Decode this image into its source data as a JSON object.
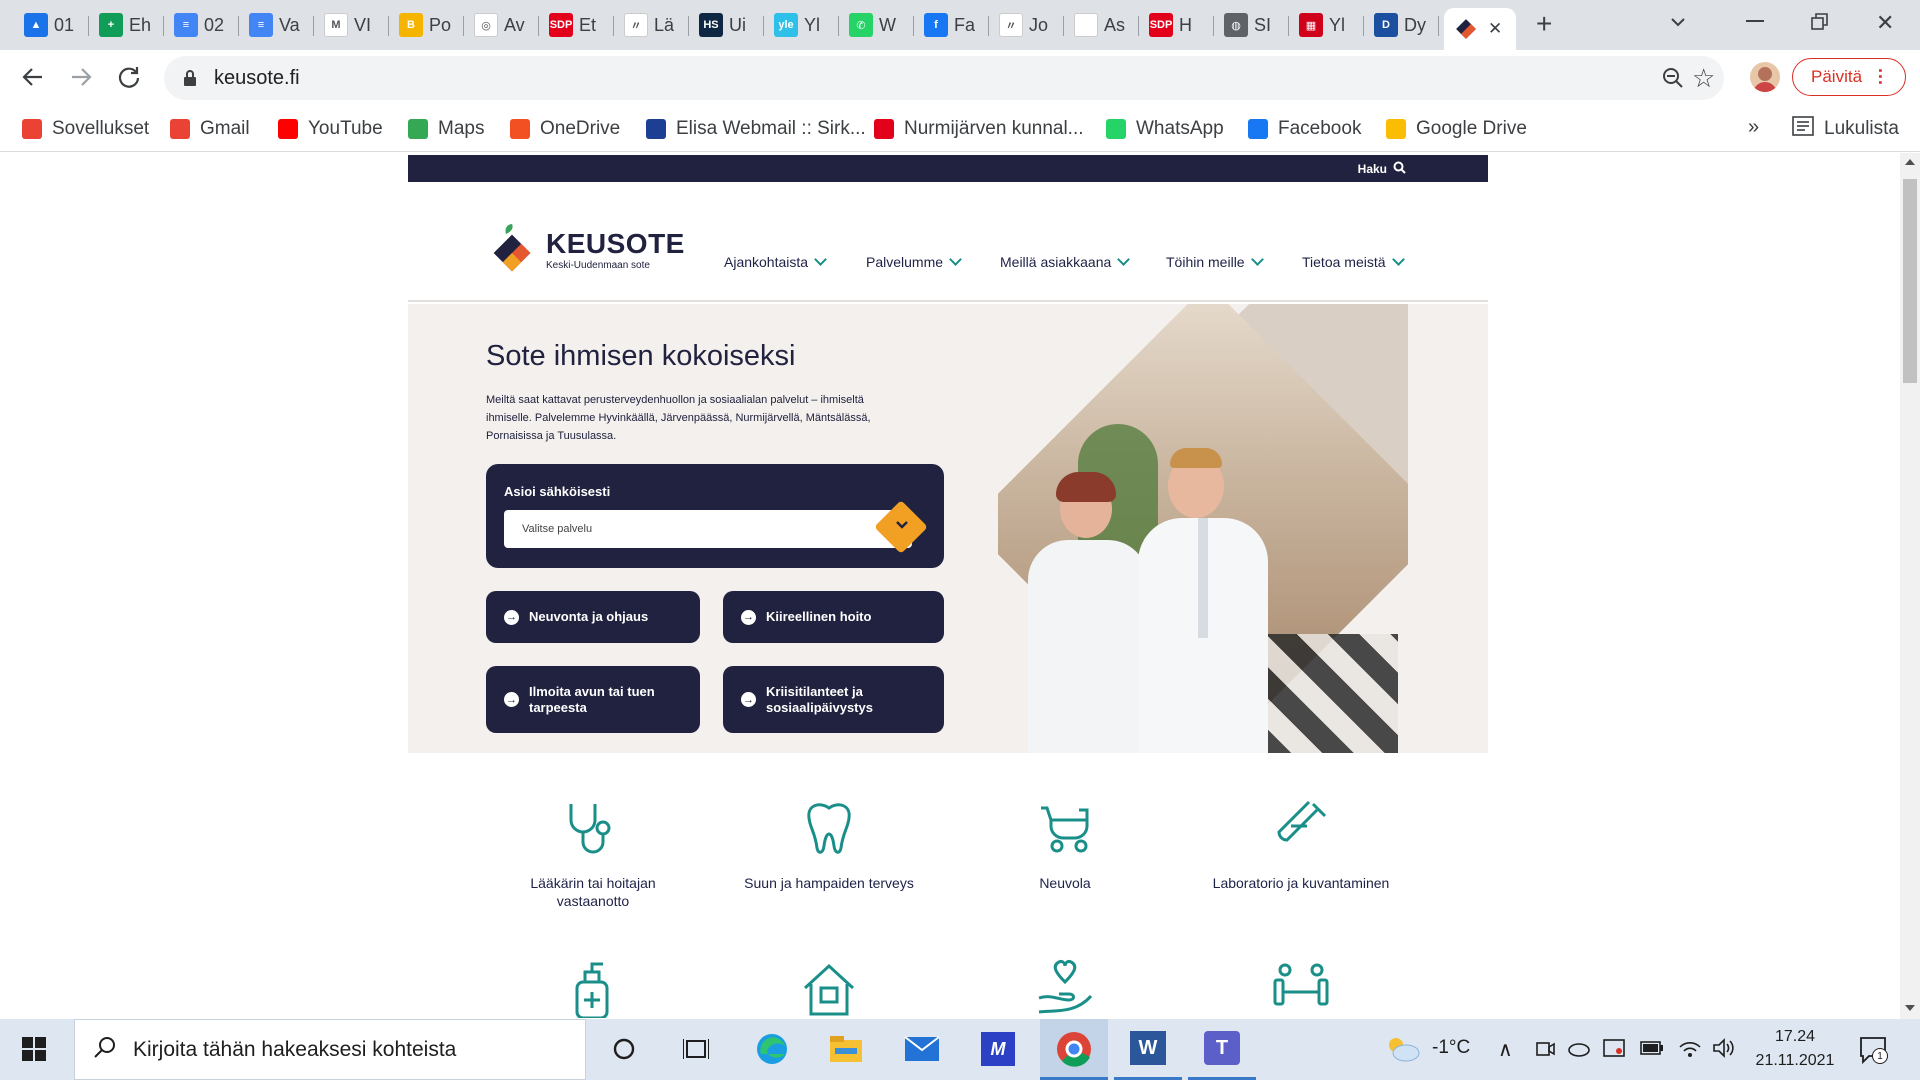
{
  "browser": {
    "tabs": [
      {
        "label": "01",
        "color": "#1a73e8",
        "glyph": "▲"
      },
      {
        "label": "Eh",
        "color": "#0f9d58",
        "glyph": "+"
      },
      {
        "label": "02",
        "color": "#4285f4",
        "glyph": "≡"
      },
      {
        "label": "Va",
        "color": "#4285f4",
        "glyph": "≡"
      },
      {
        "label": "VI",
        "color": "#ffffff",
        "glyph": "M"
      },
      {
        "label": "Po",
        "color": "#f4b400",
        "glyph": "B"
      },
      {
        "label": "Av",
        "color": "#ffffff",
        "glyph": "◎"
      },
      {
        "label": "Et",
        "color": "#e2001a",
        "glyph": "SDP"
      },
      {
        "label": "Lä",
        "color": "#ffffff",
        "glyph": "〃"
      },
      {
        "label": "Ui",
        "color": "#0e2743",
        "glyph": "HS"
      },
      {
        "label": "Yl",
        "color": "#2ec0e8",
        "glyph": "yle"
      },
      {
        "label": "W",
        "color": "#25d366",
        "glyph": "✆"
      },
      {
        "label": "Fa",
        "color": "#1877f2",
        "glyph": "f"
      },
      {
        "label": "Jo",
        "color": "#ffffff",
        "glyph": "〃"
      },
      {
        "label": "As",
        "color": "#ffffff",
        "glyph": ""
      },
      {
        "label": "H",
        "color": "#e2001a",
        "glyph": "SDP"
      },
      {
        "label": "SI",
        "color": "#5f6368",
        "glyph": "◍"
      },
      {
        "label": "Yl",
        "color": "#d0021b",
        "glyph": "▦"
      },
      {
        "label": "Dy",
        "color": "#1c4fa0",
        "glyph": "D"
      }
    ],
    "active_tab_close": "✕",
    "new_tab": "+",
    "url": "keusote.fi",
    "update_button": "Päivitä",
    "bookmarks": [
      {
        "label": "Sovellukset",
        "color": "#ea4335"
      },
      {
        "label": "Gmail",
        "color": "#ea4335"
      },
      {
        "label": "YouTube",
        "color": "#ff0000"
      },
      {
        "label": "Maps",
        "color": "#34a853"
      },
      {
        "label": "OneDrive",
        "color": "#f25022"
      },
      {
        "label": "Elisa Webmail :: Sirk...",
        "color": "#1c3f94"
      },
      {
        "label": "Nurmijärven kunnal...",
        "color": "#e2001a"
      },
      {
        "label": "WhatsApp",
        "color": "#25d366"
      },
      {
        "label": "Facebook",
        "color": "#1877f2"
      },
      {
        "label": "Google Drive",
        "color": "#fbbc04"
      }
    ],
    "more_bookmarks": "»",
    "reading_list": "Lukulista"
  },
  "site": {
    "search_label": "Haku",
    "logo_name": "KEUSOTE",
    "logo_sub": "Keski-Uudenmaan sote",
    "nav": [
      "Ajankohtaista",
      "Palvelumme",
      "Meillä asiakkaana",
      "Töihin meille",
      "Tietoa meistä"
    ],
    "hero_title": "Sote ihmisen kokoiseksi",
    "hero_text": "Meiltä saat kattavat perusterveydenhuollon ja sosiaalialan palvelut – ihmiseltä ihmiselle. Palvelemme Hyvinkäällä, Järvenpäässä, Nurmijärvellä, Mäntsälässä, Pornaisissa ja Tuusulassa.",
    "eservice_title": "Asioi sähköisesti",
    "eservice_placeholder": "Valitse palvelu",
    "buttons": [
      "Neuvonta ja ohjaus",
      "Kiireellinen hoito",
      "Ilmoita avun tai tuen tarpeesta",
      "Kriisitilanteet ja sosiaalipäivystys"
    ],
    "services": [
      "Lääkärin tai hoitajan vastaanotto",
      "Suun ja hampaiden terveys",
      "Neuvola",
      "Laboratorio ja kuvantaminen"
    ]
  },
  "taskbar": {
    "search_placeholder": "Kirjoita tähän hakeaksesi kohteista",
    "weather": "-1°C",
    "time": "17.24",
    "date": "21.11.2021",
    "notifications": "1"
  },
  "colors": {
    "navy": "#20223f",
    "teal": "#1a8f8a",
    "orange": "#f2a024",
    "hero_bg": "#f4f0ed"
  }
}
